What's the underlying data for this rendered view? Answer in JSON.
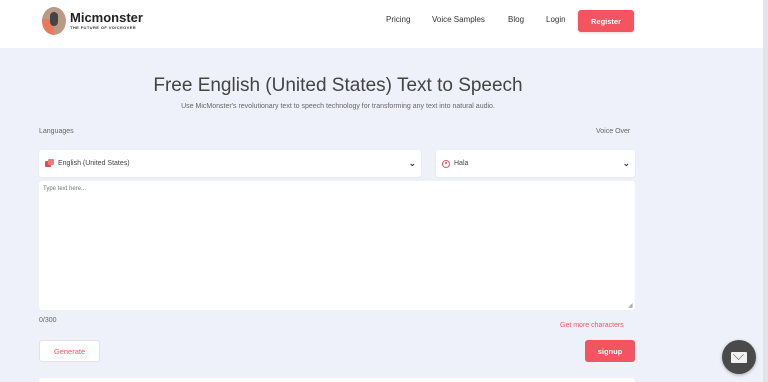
{
  "brand": {
    "name": "Micmonster",
    "tagline": "THE FUTURE OF VOICEOVER"
  },
  "nav": {
    "links": [
      "Pricing",
      "Voice Samples",
      "Blog",
      "Login"
    ],
    "register_label": "Register"
  },
  "hero": {
    "title": "Free English (United States) Text to Speech",
    "subtitle": "Use MicMonster's revolutionary text to speech technology for transforming any text into natural audio."
  },
  "form": {
    "languages_label": "Languages",
    "voice_over_label": "Voice Over",
    "language_value": "English (United States)",
    "voice_value": "Hala",
    "text_placeholder": "Type text here...",
    "counter": "0/300",
    "more_chars_link": "Get more characters",
    "generate_label": "Generate",
    "signup_label": "signup"
  },
  "colors": {
    "accent": "#f4545f",
    "background": "#eef1f9"
  },
  "icons": {
    "language": "flag-icon",
    "voice": "radio-target-icon",
    "dropdown": "chevron-down-icon",
    "chat": "envelope-icon"
  }
}
